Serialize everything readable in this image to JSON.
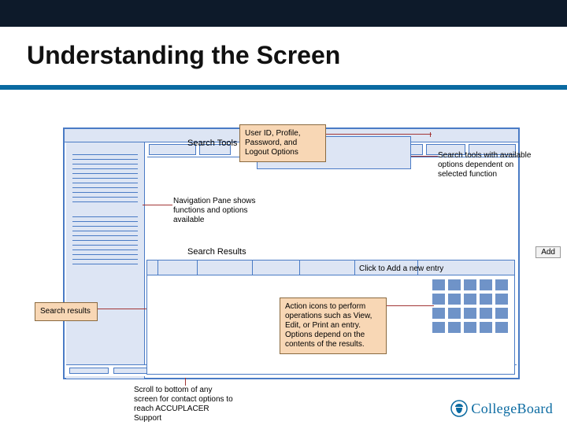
{
  "header": {
    "title": "Understanding the Screen"
  },
  "labels": {
    "search_tools": "Search Tools",
    "search_results": "Search Results",
    "add_button": "Add",
    "click_add": "Click to Add a new entry"
  },
  "callouts": {
    "user_id": "User ID, Profile, Password, and Logout Options",
    "search_tools_info": "Search tools with available options dependent on selected function",
    "nav_pane": "Navigation Pane shows functions and options available",
    "search_results": "Search results",
    "action_icons": "Action icons to perform operations such as View, Edit, or Print an entry. Options depend on the contents of the results.",
    "scroll_footer": "Scroll to bottom of any screen for contact options to reach ACCUPLACER Support"
  },
  "brand": {
    "name": "CollegeBoard"
  }
}
